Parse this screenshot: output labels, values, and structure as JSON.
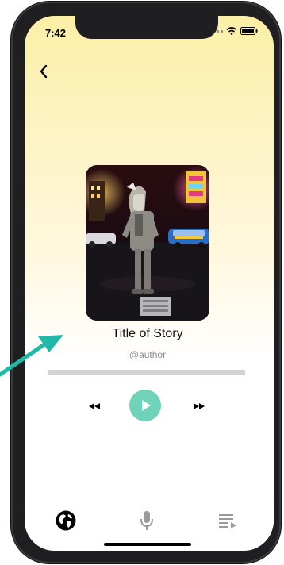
{
  "status_bar": {
    "time": "7:42"
  },
  "player": {
    "title": "Title of Story",
    "author": "@author",
    "progress": 0
  },
  "icons": {
    "back": "chevron-left-icon",
    "rewind": "rewind-icon",
    "play": "play-icon",
    "fast_forward": "fast-forward-icon",
    "tab_discover": "globe-icon",
    "tab_record": "microphone-icon",
    "tab_playlist": "playlist-icon"
  },
  "colors": {
    "accent": "#6fd3b9",
    "gradient_top": "#fbefa7",
    "arrow": "#1fb9a8",
    "progress_track": "#d3d3d3"
  }
}
